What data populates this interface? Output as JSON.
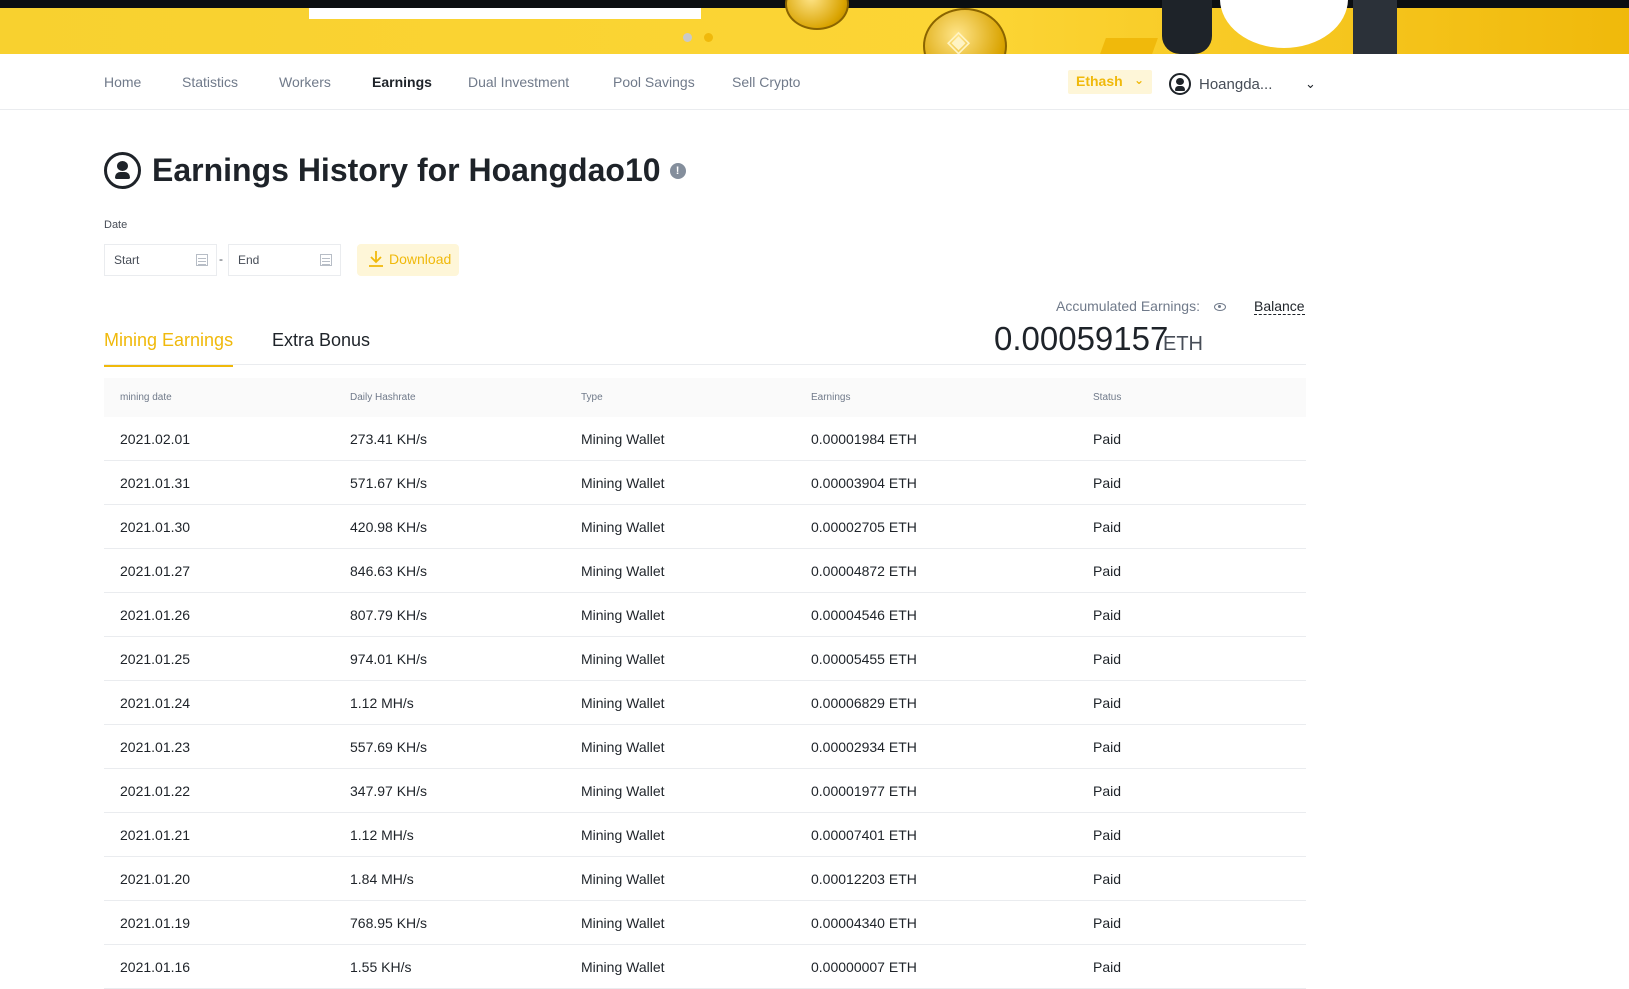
{
  "nav": {
    "items": [
      "Home",
      "Statistics",
      "Workers",
      "Earnings",
      "Dual Investment",
      "Pool Savings",
      "Sell Crypto"
    ],
    "active": "Earnings",
    "algorithm": "Ethash",
    "username": "Hoangda..."
  },
  "page": {
    "title": "Earnings History for Hoangdao10"
  },
  "filter": {
    "date_label": "Date",
    "start_placeholder": "Start",
    "end_placeholder": "End",
    "separator": "-",
    "download_label": "Download"
  },
  "tabs": {
    "mining": "Mining Earnings",
    "extra": "Extra Bonus"
  },
  "accumulated": {
    "label": "Accumulated Earnings:",
    "balance_link": "Balance",
    "value": "0.00059157",
    "unit": "ETH"
  },
  "table": {
    "headers": [
      "mining date",
      "Daily Hashrate",
      "Type",
      "Earnings",
      "Status"
    ],
    "rows": [
      [
        "2021.02.01",
        "273.41 KH/s",
        "Mining Wallet",
        "0.00001984 ETH",
        "Paid"
      ],
      [
        "2021.01.31",
        "571.67 KH/s",
        "Mining Wallet",
        "0.00003904 ETH",
        "Paid"
      ],
      [
        "2021.01.30",
        "420.98 KH/s",
        "Mining Wallet",
        "0.00002705 ETH",
        "Paid"
      ],
      [
        "2021.01.27",
        "846.63 KH/s",
        "Mining Wallet",
        "0.00004872 ETH",
        "Paid"
      ],
      [
        "2021.01.26",
        "807.79 KH/s",
        "Mining Wallet",
        "0.00004546 ETH",
        "Paid"
      ],
      [
        "2021.01.25",
        "974.01 KH/s",
        "Mining Wallet",
        "0.00005455 ETH",
        "Paid"
      ],
      [
        "2021.01.24",
        "1.12 MH/s",
        "Mining Wallet",
        "0.00006829 ETH",
        "Paid"
      ],
      [
        "2021.01.23",
        "557.69 KH/s",
        "Mining Wallet",
        "0.00002934 ETH",
        "Paid"
      ],
      [
        "2021.01.22",
        "347.97 KH/s",
        "Mining Wallet",
        "0.00001977 ETH",
        "Paid"
      ],
      [
        "2021.01.21",
        "1.12 MH/s",
        "Mining Wallet",
        "0.00007401 ETH",
        "Paid"
      ],
      [
        "2021.01.20",
        "1.84 MH/s",
        "Mining Wallet",
        "0.00012203 ETH",
        "Paid"
      ],
      [
        "2021.01.19",
        "768.95 KH/s",
        "Mining Wallet",
        "0.00004340 ETH",
        "Paid"
      ],
      [
        "2021.01.16",
        "1.55 KH/s",
        "Mining Wallet",
        "0.00000007 ETH",
        "Paid"
      ]
    ]
  },
  "colors": {
    "brand_yellow": "#f0b90b",
    "text_primary": "#1e2329",
    "text_secondary": "#707a8a"
  }
}
